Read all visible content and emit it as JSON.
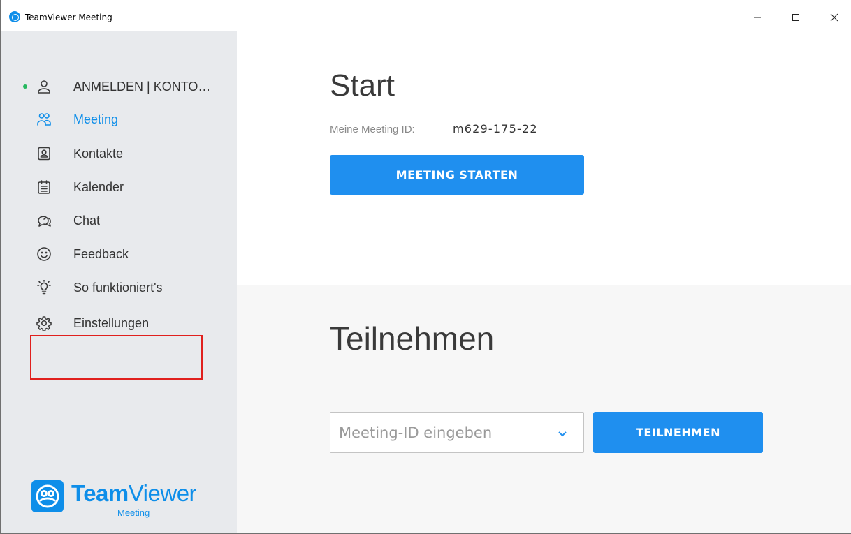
{
  "window": {
    "title": "TeamViewer Meeting",
    "controls": {
      "minimize": "minimize-icon",
      "maximize": "maximize-icon",
      "close": "close-icon"
    }
  },
  "sidebar": {
    "account": {
      "label": "ANMELDEN | KONTO…",
      "icon": "user-icon",
      "status_color": "#26b85f"
    },
    "items": [
      {
        "label": "Meeting",
        "icon": "people-icon",
        "active": true
      },
      {
        "label": "Kontakte",
        "icon": "contact-card-icon",
        "active": false
      },
      {
        "label": "Kalender",
        "icon": "calendar-icon",
        "active": false
      },
      {
        "label": "Chat",
        "icon": "chat-bubbles-icon",
        "active": false
      },
      {
        "label": "Feedback",
        "icon": "smiley-icon",
        "active": false
      },
      {
        "label": "So funktioniert's",
        "icon": "lightbulb-icon",
        "active": false
      },
      {
        "label": "Einstellungen",
        "icon": "gear-icon",
        "active": false,
        "highlighted": true
      }
    ],
    "logo": {
      "word_bold": "Team",
      "word_regular": "Viewer",
      "sub": "Meeting"
    }
  },
  "start": {
    "heading": "Start",
    "id_label": "Meine Meeting ID:",
    "id_value": "m629-175-22",
    "button_label": "MEETING STARTEN"
  },
  "join": {
    "heading": "Teilnehmen",
    "input_placeholder": "Meeting-ID eingeben",
    "button_label": "TEILNEHMEN"
  },
  "colors": {
    "accent": "#1f8fef",
    "sidebar_bg": "#e8eaed",
    "highlight_border": "#e0201e"
  }
}
